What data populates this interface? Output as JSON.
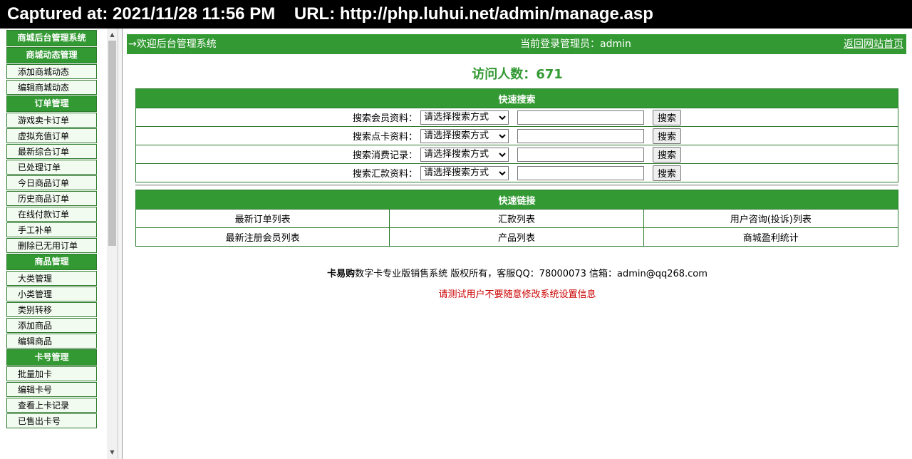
{
  "capture": {
    "text": "Captured at: 2021/11/28 11:56 PM    URL: http://php.luhui.net/admin/manage.asp"
  },
  "sidebar": {
    "title": "商城后台管理系统",
    "sections": [
      {
        "head": "商城动态管理",
        "items": [
          "添加商城动态",
          "编辑商城动态"
        ]
      },
      {
        "head": "订单管理",
        "items": [
          "游戏卖卡订单",
          "虚拟充值订单",
          "最新综合订单",
          "已处理订单",
          "今日商品订单",
          "历史商品订单",
          "在线付款订单",
          "手工补单",
          "删除已无用订单"
        ]
      },
      {
        "head": "商品管理",
        "items": [
          "大类管理",
          "小类管理",
          "类别转移",
          "添加商品",
          "编辑商品"
        ]
      },
      {
        "head": "卡号管理",
        "items": [
          "批量加卡",
          "编辑卡号",
          "查看上卡记录",
          "已售出卡号"
        ]
      }
    ]
  },
  "topbar": {
    "welcome": "→欢迎后台管理系统",
    "current_admin": "当前登录管理员：admin",
    "home_link": "返回网站首页"
  },
  "visitors": "访问人数：671",
  "quick_search": {
    "title": "快速搜索",
    "select_placeholder": "请选择搜索方式",
    "button": "搜索",
    "rows": [
      "搜索会员资料：",
      "搜索点卡资料：",
      "搜索消费记录：",
      "搜索汇款资料："
    ]
  },
  "quick_links": {
    "title": "快速链接",
    "rows": [
      [
        "最新订单列表",
        "汇款列表",
        "用户咨询(投诉)列表"
      ],
      [
        "最新注册会员列表",
        "产品列表",
        "商城盈利统计"
      ]
    ]
  },
  "footer": {
    "brand": "卡易购",
    "text": "数字卡专业版销售系统 版权所有，客服QQ：78000073 信箱：admin@qq268.com",
    "warning": "请测试用户不要随意修改系统设置信息"
  }
}
